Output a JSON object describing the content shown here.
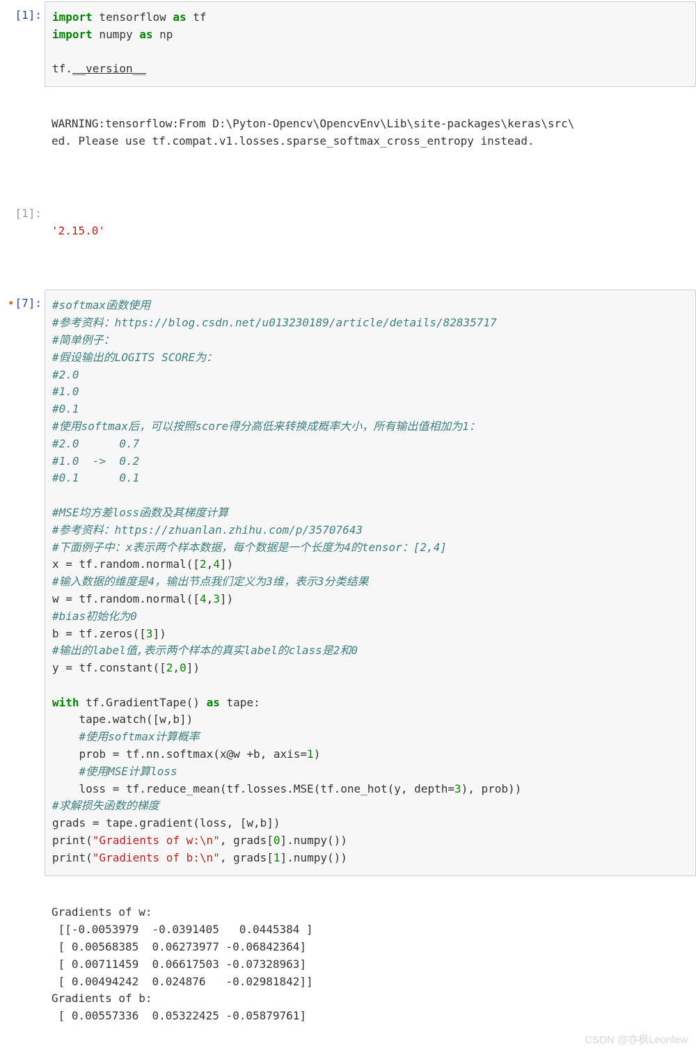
{
  "cells": {
    "c1": {
      "prompt": "[1]:",
      "code": {
        "l1a": "import",
        "l1b": " tensorflow ",
        "l1c": "as",
        "l1d": " tf",
        "l2a": "import",
        "l2b": " numpy ",
        "l2c": "as",
        "l2d": " np",
        "l3a": "tf.",
        "l3b": "__version__"
      }
    },
    "warn": {
      "l1": "WARNING:tensorflow:From D:\\Pyton-Opencv\\OpencvEnv\\Lib\\site-packages\\keras\\src\\",
      "l2": "ed. Please use tf.compat.v1.losses.sparse_softmax_cross_entropy instead."
    },
    "out1": {
      "prompt": "[1]:",
      "text": "'2.15.0'"
    },
    "c7": {
      "prompt": "[7]:",
      "cm01": "#softmax函数使用",
      "cm02": "#参考资料：https://blog.csdn.net/u013230189/article/details/82835717",
      "cm03": "#简单例子：",
      "cm04": "#假设输出的LOGITS SCORE为：",
      "cm05": "#2.0",
      "cm06": "#1.0",
      "cm07": "#0.1",
      "cm08": "#使用softmax后，可以按照score得分高低来转换成概率大小，所有输出值相加为1：",
      "cm09": "#2.0      0.7",
      "cm10": "#1.0  ->  0.2",
      "cm11": "#0.1      0.1",
      "cm12": "#MSE均方差loss函数及其梯度计算",
      "cm13": "#参考资料：https://zhuanlan.zhihu.com/p/35707643",
      "cm14": "#下面例子中：x表示两个样本数据，每个数据是一个长度为4的tensor：[2,4]",
      "st01": "x = tf.random.normal([",
      "st01n": "2",
      "st01m": ",",
      "st01n2": "4",
      "st01e": "])",
      "cm15": "#输入数据的维度是4，输出节点我们定义为3维，表示3分类结果",
      "st02": "w = tf.random.normal([",
      "st02n": "4",
      "st02m": ",",
      "st02n2": "3",
      "st02e": "])",
      "cm16": "#bias初始化为0",
      "st03": "b = tf.zeros([",
      "st03n": "3",
      "st03e": "])",
      "cm17": "#输出的label值,表示两个样本的真实label的class是2和0",
      "st04": "y = tf.constant([",
      "st04n": "2",
      "st04m": ",",
      "st04n2": "0",
      "st04e": "])",
      "with_kw": "with",
      "with_rest": " tf.GradientTape() ",
      "as_kw": "as",
      "as_rest": " tape:",
      "wt01": "    tape.watch([w,b])",
      "cm18": "    #使用softmax计算概率",
      "wt02a": "    prob = tf.nn.softmax(x@w +b, axis=",
      "wt02n": "1",
      "wt02e": ")",
      "cm19": "    #使用MSE计算loss",
      "wt03a": "    loss = tf.reduce_mean(tf.losses.MSE(tf.one_hot(y, depth=",
      "wt03n": "3",
      "wt03e": "), prob))",
      "cm20": "#求解损失函数的梯度",
      "st05": "grads = tape.gradient(loss, [w,b])",
      "pr1a": "print(",
      "pr1s": "\"Gradients of w:\\n\"",
      "pr1b": ", grads[",
      "pr1n": "0",
      "pr1c": "].numpy())",
      "pr2a": "print(",
      "pr2s": "\"Gradients of b:\\n\"",
      "pr2b": ", grads[",
      "pr2n": "1",
      "pr2c": "].numpy())"
    },
    "out7": {
      "l1": "Gradients of w:",
      "l2": " [[-0.0053979  -0.0391405   0.0445384 ]",
      "l3": " [ 0.00568385  0.06273977 -0.06842364]",
      "l4": " [ 0.00711459  0.06617503 -0.07328963]",
      "l5": " [ 0.00494242  0.024876   -0.02981842]]",
      "l6": "Gradients of b:",
      "l7": " [ 0.00557336  0.05322425 -0.05879761]"
    }
  },
  "watermark": "CSDN @亦枫Leonlew"
}
